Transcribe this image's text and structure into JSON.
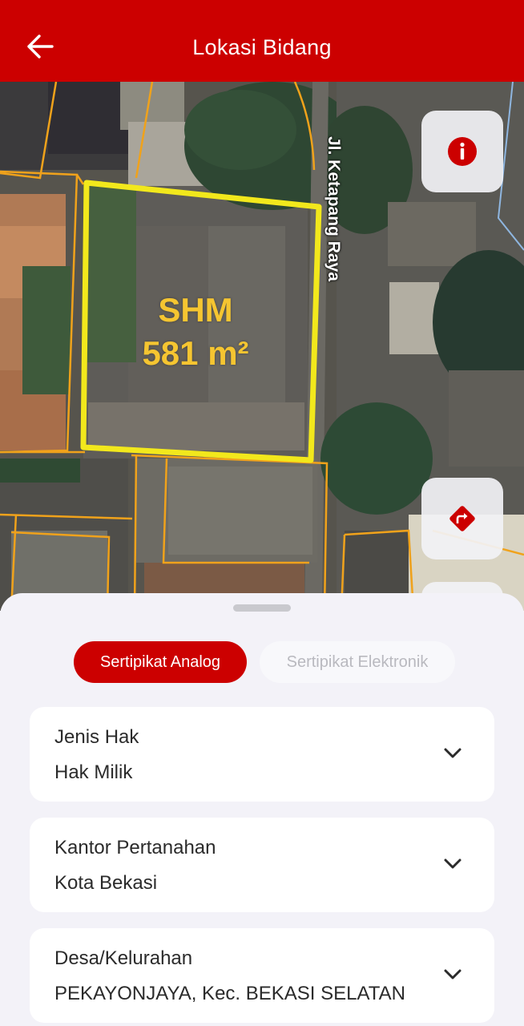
{
  "app_bar": {
    "title": "Lokasi Bidang",
    "back_icon": "arrow-left-icon",
    "background_color": "#cc0000"
  },
  "map": {
    "parcel": {
      "type": "SHM",
      "area": "581 m²",
      "outline_color": "#f2e81c",
      "label_color": "#f5c531"
    },
    "neighbor_outline_color": "#f0a21b",
    "street_name": "Jl. Ketapang Raya",
    "buttons": {
      "info_icon": "info-icon",
      "directions_icon": "directions-icon"
    }
  },
  "bottom_sheet": {
    "tabs": [
      {
        "label": "Sertipikat Analog",
        "selected": true
      },
      {
        "label": "Sertipikat Elektronik",
        "selected": false
      }
    ],
    "cards": [
      {
        "label": "Jenis Hak",
        "value": "Hak Milik"
      },
      {
        "label": "Kantor Pertanahan",
        "value": "Kota Bekasi"
      },
      {
        "label": "Desa/Kelurahan",
        "value": "PEKAYONJAYA, Kec. BEKASI SELATAN"
      }
    ],
    "expand_icon": "chevron-down-icon"
  }
}
